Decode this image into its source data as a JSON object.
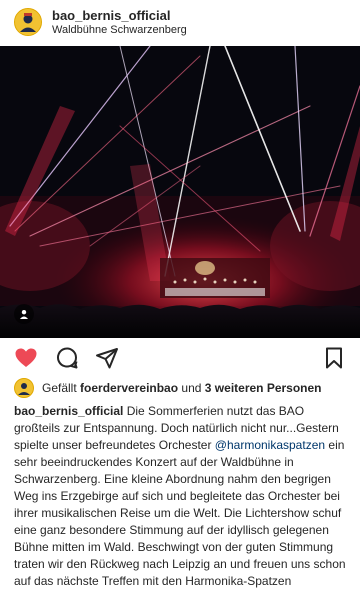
{
  "post": {
    "username": "bao_bernis_official",
    "location": "Waldbühne Schwarzenberg"
  },
  "likes": {
    "prefix": "Gefällt",
    "user": "foerdervereinbao",
    "connector": "und",
    "others": "3 weiteren Personen"
  },
  "caption": {
    "username": "bao_bernis_official",
    "text_part1": "Die Sommerferien nutzt das BAO großteils zur Entspannung. Doch natürlich nicht nur...Gestern spielte unser befreundetes Orchester",
    "mention": "@harmonikaspatzen",
    "text_part2": "ein sehr beeindruckendes Konzert auf der Waldbühne in Schwarzenberg. Eine kleine Abordnung nahm den begrigen Weg ins Erzgebirge auf sich und begleitete das Orchester bei ihrer musikalischen Reise um die Welt. Die Lichtershow schuf eine ganz besondere Stimmung auf der idyllisch gelegenen Bühne mitten im Wald. Beschwingt von der guten Stimmung traten wir den Rückweg nach Leipzig an und freuen uns schon auf das nächste Treffen mit den Harmonika-Spatzen"
  },
  "colors": {
    "heart": "#ed4956",
    "text": "#262626",
    "mention": "#00376b"
  },
  "icons": {
    "like": "heart-icon",
    "comment": "comment-icon",
    "share": "send-icon",
    "save": "bookmark-icon",
    "tag": "user-tag-icon"
  }
}
